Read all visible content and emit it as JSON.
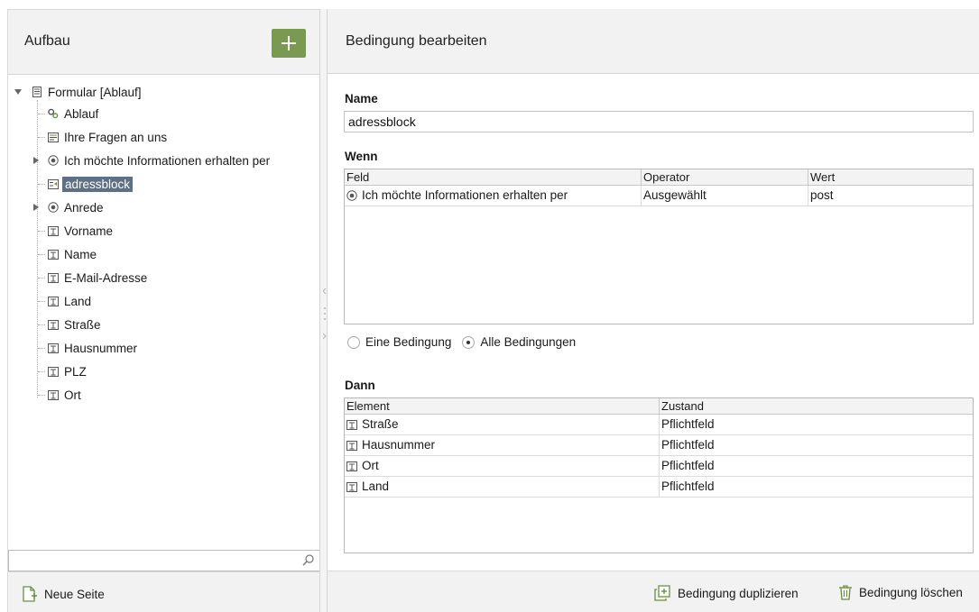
{
  "left": {
    "title": "Aufbau",
    "tree": [
      {
        "label": "Formular [Ablauf]",
        "icon": "form-icon",
        "level": 0,
        "expanded": true
      },
      {
        "label": "Ablauf",
        "icon": "gears-icon",
        "level": 1
      },
      {
        "label": "Ihre Fragen an uns",
        "icon": "textarea-icon",
        "level": 1
      },
      {
        "label": "Ich möchte Informationen erhalten per",
        "icon": "radio-icon",
        "level": 1,
        "collapsed": true
      },
      {
        "label": "adressblock",
        "icon": "condition-icon",
        "level": 1,
        "selected": true
      },
      {
        "label": "Anrede",
        "icon": "radio-icon",
        "level": 1,
        "collapsed": true
      },
      {
        "label": "Vorname",
        "icon": "textfield-icon",
        "level": 1
      },
      {
        "label": "Name",
        "icon": "textfield-icon",
        "level": 1
      },
      {
        "label": "E-Mail-Adresse",
        "icon": "textfield-icon",
        "level": 1
      },
      {
        "label": "Land",
        "icon": "textfield-icon",
        "level": 1
      },
      {
        "label": "Straße",
        "icon": "textfield-icon",
        "level": 1
      },
      {
        "label": "Hausnummer",
        "icon": "textfield-icon",
        "level": 1
      },
      {
        "label": "PLZ",
        "icon": "textfield-icon",
        "level": 1
      },
      {
        "label": "Ort",
        "icon": "textfield-icon",
        "level": 1
      }
    ],
    "search_value": "",
    "new_page_label": "Neue Seite"
  },
  "right": {
    "title": "Bedingung bearbeiten",
    "name_label": "Name",
    "name_value": "adressblock",
    "wenn_label": "Wenn",
    "wenn_columns": [
      "Feld",
      "Operator",
      "Wert"
    ],
    "wenn_rows": [
      {
        "feld": "Ich möchte Informationen erhalten per",
        "operator": "Ausgewählt",
        "wert": "post"
      }
    ],
    "mode_options": [
      "Eine Bedingung",
      "Alle Bedingungen"
    ],
    "mode_selected": "Alle Bedingungen",
    "dann_label": "Dann",
    "dann_columns": [
      "Element",
      "Zustand"
    ],
    "dann_rows": [
      {
        "element": "Straße",
        "zustand": "Pflichtfeld"
      },
      {
        "element": "Hausnummer",
        "zustand": "Pflichtfeld"
      },
      {
        "element": "Ort",
        "zustand": "Pflichtfeld"
      },
      {
        "element": "Land",
        "zustand": "Pflichtfeld"
      }
    ],
    "duplicate_label": "Bedingung duplizieren",
    "delete_label": "Bedingung löschen"
  },
  "colors": {
    "accent_green": "#7a9a52",
    "selection": "#5e6f86"
  }
}
